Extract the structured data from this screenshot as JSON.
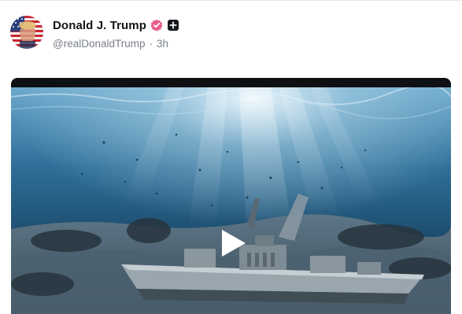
{
  "post": {
    "author": {
      "display_name": "Donald J. Trump",
      "handle": "@realDonaldTrump",
      "separator": "·",
      "timestamp": "3h",
      "verified_badge_color": "#e85d8f",
      "avatar_icon": "flag-portrait-avatar"
    },
    "media": {
      "type": "video",
      "description_icon": "play-icon",
      "colors": {
        "water_deep": "#0b2a44",
        "water_light": "#5f9fc4",
        "light_ray": "#e8f4f8"
      }
    }
  }
}
